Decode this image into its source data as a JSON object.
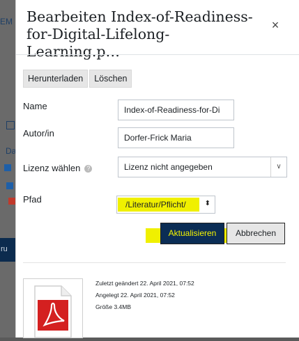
{
  "background": {
    "fragments": [
      "EM",
      "Da",
      "ru"
    ]
  },
  "dialog": {
    "title": "Bearbeiten Index-of-Readiness-for-Digital-Lifelong-Learning.p…",
    "close_icon": "×"
  },
  "toolbar": {
    "download_label": "Herunterladen",
    "delete_label": "Löschen"
  },
  "form": {
    "name_label": "Name",
    "name_value": "Index-of-Readiness-for-Di",
    "author_label": "Autor/in",
    "author_value": "Dorfer-Frick Maria",
    "license_label": "Lizenz wählen",
    "license_value": "Lizenz nicht angegeben",
    "path_label": "Pfad",
    "path_value": "/Literatur/Pflicht/"
  },
  "actions": {
    "update_label": "Aktualisieren",
    "cancel_label": "Abbrechen"
  },
  "file_info": {
    "modified": "Zuletzt geändert  22. April 2021, 07:52",
    "created": "Angelegt  22. April 2021, 07:52",
    "size": "Größe  3.4MB"
  },
  "colors": {
    "primary": "#0b2d55",
    "highlight": "#f0f000",
    "pdf_red": "#d42020"
  },
  "icons": [
    "close-icon",
    "help-icon",
    "chevron-down-icon",
    "sort-icon",
    "pdf-icon"
  ]
}
